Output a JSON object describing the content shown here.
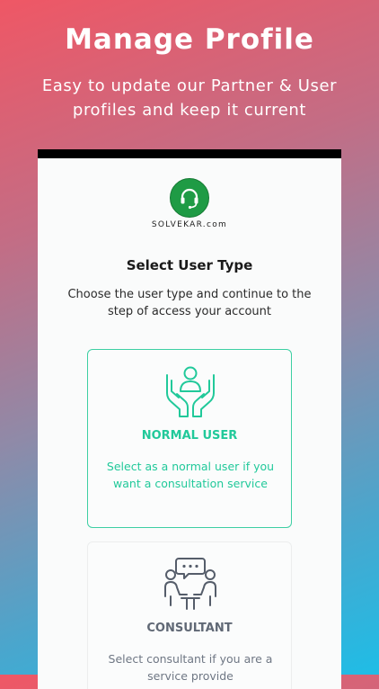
{
  "promo": {
    "headline": "Manage Profile",
    "subline": "Easy to update our Partner & User profiles and keep it current"
  },
  "app": {
    "logo_text": "SOLVEKAR.com",
    "title": "Select User Type",
    "description": "Choose the user type and continue to the step of access your account",
    "brand_color": "#1f9b45",
    "accent_color": "#21c99a"
  },
  "cards": [
    {
      "label": "NORMAL USER",
      "text": "Select as a normal user if you want a consultation service",
      "icon": "hands-user-icon"
    },
    {
      "label": "CONSULTANT",
      "text": "Select consultant if you are a service provide",
      "icon": "consultant-chat-icon"
    }
  ]
}
